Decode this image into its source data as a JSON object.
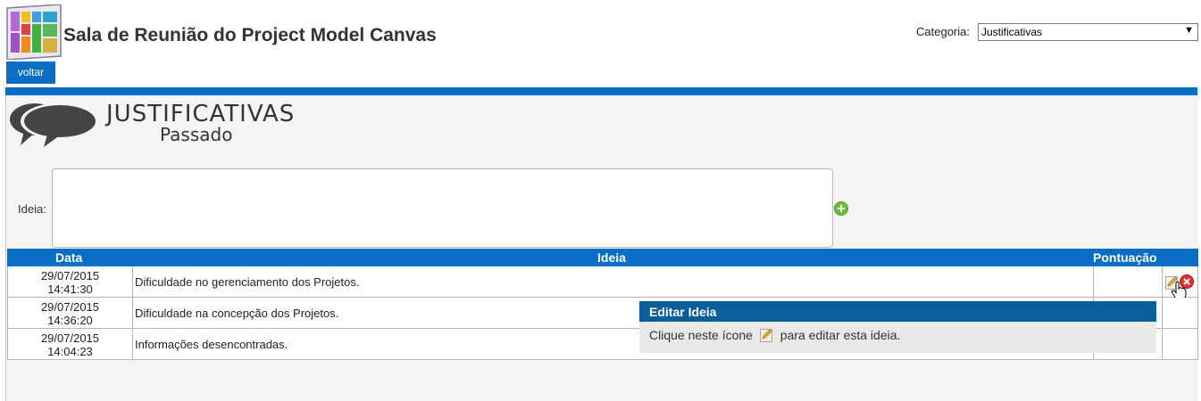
{
  "header": {
    "title": "Sala de Reunião do Project Model Canvas",
    "category_label": "Categoria:",
    "category_value": "Justificativas",
    "back_label": "voltar"
  },
  "section": {
    "title": "JUSTIFICATIVAS",
    "subtitle": "Passado"
  },
  "form": {
    "idea_label": "Ideia:",
    "idea_value": ""
  },
  "table": {
    "columns": [
      "Data",
      "Ideia",
      "Pontuação"
    ],
    "rows": [
      {
        "date": "29/07/2015",
        "time": "14:41:30",
        "idea": "Dificuldade no gerenciamento dos Projetos.",
        "score": ""
      },
      {
        "date": "29/07/2015",
        "time": "14:36:20",
        "idea": "Dificuldade na concepção dos Projetos.",
        "score": ""
      },
      {
        "date": "29/07/2015",
        "time": "14:04:23",
        "idea": "Informações desencontradas.",
        "score": ""
      }
    ]
  },
  "tooltip": {
    "title": "Editar Ideia",
    "text_before": "Clique neste ícone",
    "text_after": "para editar esta ideia."
  },
  "colors": {
    "accent": "#0a6ec5",
    "tooltip_header": "#0a5e99",
    "panel_bg": "#f5f4f3"
  }
}
